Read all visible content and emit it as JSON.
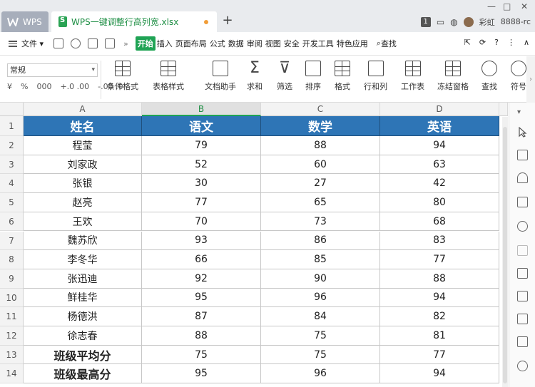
{
  "titlebar": {
    "app_tab": "WPS",
    "file_tab": "WPS一键调整行高列宽.xlsx",
    "new_tab": "+",
    "badge": "1",
    "user": "彩虹",
    "account": "8888-rc",
    "win_min": "—",
    "win_max": "□",
    "win_close": "✕"
  },
  "menubar": {
    "file": "文件",
    "items": [
      "开始",
      "插入",
      "页面布局",
      "公式",
      "数据",
      "审阅",
      "视图",
      "安全",
      "开发工具",
      "特色应用"
    ],
    "more": "»",
    "search": "查找",
    "help": "?",
    "minimize_ribbon": "∧"
  },
  "ribbon": {
    "number_format": "常规",
    "num_buttons": [
      "%",
      "000",
      "+.0 .00",
      "-.00 .0"
    ],
    "currency": "¥",
    "buttons": [
      {
        "label": "条件格式",
        "icon": "conditional-format-icon"
      },
      {
        "label": "表格样式",
        "icon": "table-style-icon"
      },
      {
        "label": "文档助手",
        "icon": "doc-assistant-icon"
      },
      {
        "label": "求和",
        "icon": "sum-icon"
      },
      {
        "label": "筛选",
        "icon": "filter-icon"
      },
      {
        "label": "排序",
        "icon": "sort-icon"
      },
      {
        "label": "格式",
        "icon": "format-icon"
      },
      {
        "label": "行和列",
        "icon": "row-col-icon"
      },
      {
        "label": "工作表",
        "icon": "worksheet-icon"
      },
      {
        "label": "冻结窗格",
        "icon": "freeze-icon"
      },
      {
        "label": "查找",
        "icon": "find-icon"
      },
      {
        "label": "符号",
        "icon": "symbol-icon"
      }
    ]
  },
  "sheet": {
    "columns": [
      "A",
      "B",
      "C",
      "D"
    ],
    "rows": [
      "1",
      "2",
      "3",
      "4",
      "5",
      "6",
      "7",
      "8",
      "9",
      "10",
      "11",
      "12",
      "13",
      "14"
    ],
    "header": [
      "姓名",
      "语文",
      "数学",
      "英语"
    ],
    "data": [
      [
        "程莹",
        "79",
        "88",
        "94"
      ],
      [
        "刘家政",
        "52",
        "60",
        "63"
      ],
      [
        "张银",
        "30",
        "27",
        "42"
      ],
      [
        "赵亮",
        "77",
        "65",
        "80"
      ],
      [
        "王欢",
        "70",
        "73",
        "68"
      ],
      [
        "魏苏欣",
        "93",
        "86",
        "83"
      ],
      [
        "李冬华",
        "66",
        "85",
        "77"
      ],
      [
        "张迅迪",
        "92",
        "90",
        "88"
      ],
      [
        "鲜桂华",
        "95",
        "96",
        "94"
      ],
      [
        "杨德洪",
        "87",
        "84",
        "82"
      ],
      [
        "徐志春",
        "88",
        "75",
        "81"
      ],
      [
        "班级平均分",
        "75",
        "75",
        "77"
      ],
      [
        "班级最高分",
        "95",
        "96",
        "94"
      ]
    ]
  }
}
